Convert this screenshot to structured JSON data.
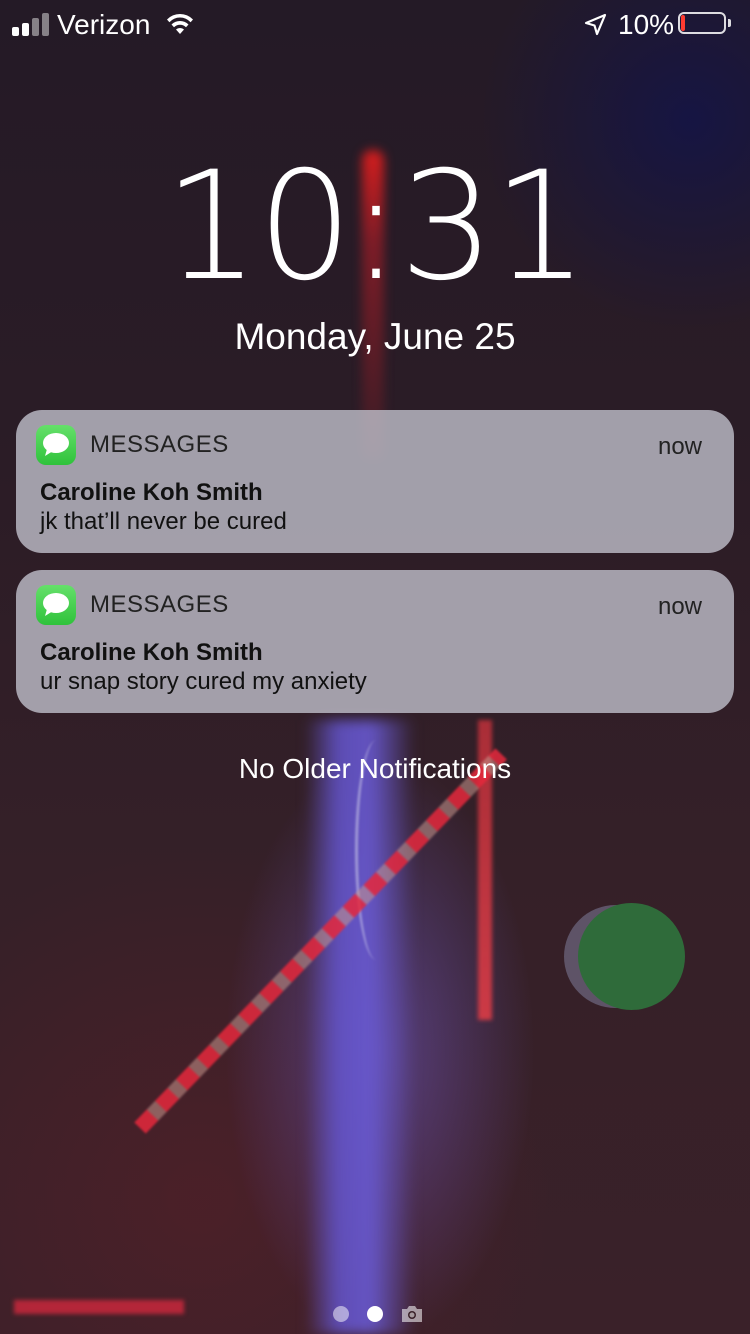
{
  "status_bar": {
    "carrier": "Verizon",
    "signal_bars_active": 2,
    "signal_bars_total": 4,
    "wifi_icon": "wifi-icon",
    "location_icon": "location-arrow-icon",
    "battery_percent_label": "10%",
    "battery_level": 0.1,
    "battery_color": "#ff3b30"
  },
  "lock_screen": {
    "time": "10:31",
    "date": "Monday, June 25"
  },
  "notifications": [
    {
      "app": "MESSAGES",
      "time": "now",
      "sender": "Caroline Koh Smith",
      "message": "jk that’ll never be cured",
      "icon": "messages-app-icon"
    },
    {
      "app": "MESSAGES",
      "time": "now",
      "sender": "Caroline Koh Smith",
      "message": "ur snap story cured my anxiety",
      "icon": "messages-app-icon"
    }
  ],
  "footer": {
    "no_older": "No Older Notifications",
    "page_count": 2,
    "current_page": 2,
    "camera_icon": "camera-icon"
  },
  "colors": {
    "messages_green": "#34c759",
    "notification_bg": "#c4c4d0"
  }
}
